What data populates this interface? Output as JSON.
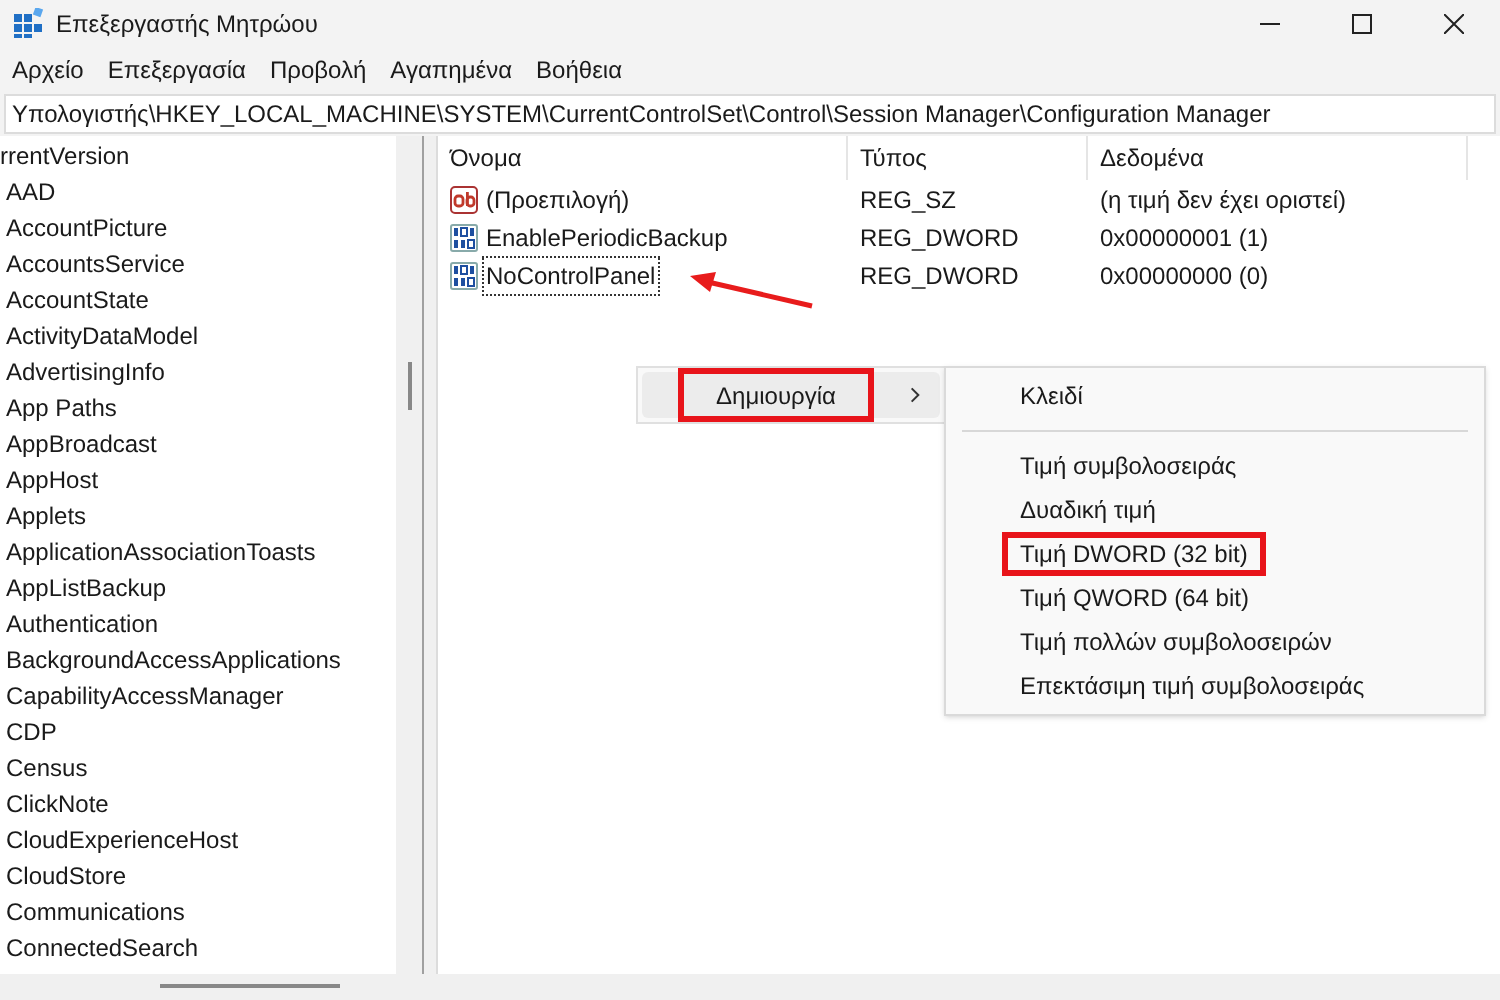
{
  "window": {
    "title": "Επεξεργαστής Μητρώου"
  },
  "menu": [
    "Αρχείο",
    "Επεξεργασία",
    "Προβολή",
    "Αγαπημένα",
    "Βοήθεια"
  ],
  "address": "Υπολογιστής\\HKEY_LOCAL_MACHINE\\SYSTEM\\CurrentControlSet\\Control\\Session Manager\\Configuration Manager",
  "tree": [
    "rrentVersion",
    "AAD",
    "AccountPicture",
    "AccountsService",
    "AccountState",
    "ActivityDataModel",
    "AdvertisingInfo",
    "App Paths",
    "AppBroadcast",
    "AppHost",
    "Applets",
    "ApplicationAssociationToasts",
    "AppListBackup",
    "Authentication",
    "BackgroundAccessApplications",
    "CapabilityAccessManager",
    "CDP",
    "Census",
    "ClickNote",
    "CloudExperienceHost",
    "CloudStore",
    "Communications",
    "ConnectedSearch"
  ],
  "columns": [
    "Όνομα",
    "Τύπος",
    "Δεδομένα"
  ],
  "rows": [
    {
      "kind": "string",
      "name": "(Προεπιλογή)",
      "type": "REG_SZ",
      "data": "(η τιμή δεν έχει οριστεί)",
      "focused": false,
      "pointed": false
    },
    {
      "kind": "binary",
      "name": "EnablePeriodicBackup",
      "type": "REG_DWORD",
      "data": "0x00000001 (1)",
      "focused": false,
      "pointed": false
    },
    {
      "kind": "binary",
      "name": "NoControlPanel",
      "type": "REG_DWORD",
      "data": "0x00000000 (0)",
      "focused": true,
      "pointed": true
    }
  ],
  "context_menu": [
    {
      "label": "Δημιουργία",
      "submenu": true,
      "highlighted": true
    }
  ],
  "submenu": [
    {
      "kind": "item",
      "label": "Κλειδί",
      "highlighted": false
    },
    {
      "kind": "separator"
    },
    {
      "kind": "item",
      "label": "Τιμή συμβολοσειράς",
      "highlighted": false
    },
    {
      "kind": "item",
      "label": "Δυαδική τιμή",
      "highlighted": false
    },
    {
      "kind": "item",
      "label": "Τιμή DWORD (32 bit)",
      "highlighted": true
    },
    {
      "kind": "item",
      "label": "Τιμή QWORD (64 bit)",
      "highlighted": false
    },
    {
      "kind": "item",
      "label": "Τιμή πολλών συμβολοσειρών",
      "highlighted": false
    },
    {
      "kind": "item",
      "label": "Επεκτάσιμη τιμή συμβολοσειράς",
      "highlighted": false
    }
  ]
}
